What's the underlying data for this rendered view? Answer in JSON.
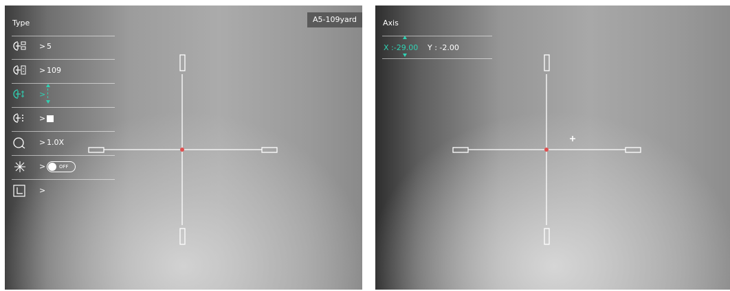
{
  "left_view": {
    "menu_title": "Type",
    "profile_badge": "A5-109yard",
    "menu_items": [
      {
        "icon": "reticle-type-icon",
        "value": "5"
      },
      {
        "icon": "distance-icon",
        "value": "109"
      },
      {
        "icon": "reticle-adjust-icon",
        "value": ""
      },
      {
        "icon": "reticle-color-icon",
        "value": ""
      },
      {
        "icon": "zoom-icon",
        "value": "1.0X"
      },
      {
        "icon": "freeze-icon",
        "value": ""
      },
      {
        "icon": "axis-icon",
        "value": ""
      }
    ],
    "freeze_toggle_label": "OFF",
    "chevron": ">"
  },
  "right_view": {
    "menu_title": "Axis",
    "x_label": "X :-29.00",
    "y_label": "Y : -2.00"
  },
  "colors": {
    "accent_teal": "#2fd3b4",
    "reticle_center_red": "#e05050",
    "text_white": "#ffffff"
  }
}
